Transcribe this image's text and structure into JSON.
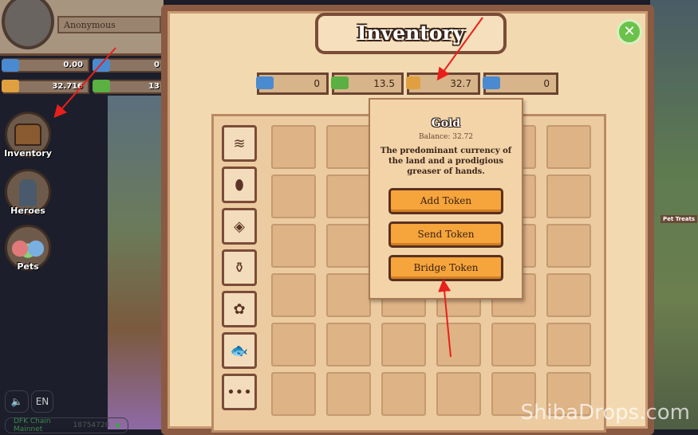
{
  "profile": {
    "name": "Anonymous"
  },
  "sidebar_balances": [
    "0.00",
    "0",
    "32.716",
    "13"
  ],
  "nav": [
    {
      "label": "Inventory"
    },
    {
      "label": "Heroes"
    },
    {
      "label": "Pets"
    }
  ],
  "footer": {
    "sound_icon": "speaker-icon",
    "language": "EN",
    "network": "DFK Chain Mainnet",
    "block": "18754728",
    "status_color": "#3fa34d"
  },
  "modal": {
    "title": "Inventory",
    "close_icon": "close-icon",
    "currencies": [
      {
        "icon": "crystal-icon",
        "value": "0",
        "color": "#4a8ad0"
      },
      {
        "icon": "jewel-icon",
        "value": "13.5",
        "color": "#5ab040"
      },
      {
        "icon": "gold-icon",
        "value": "32.7",
        "color": "#e0a040"
      },
      {
        "icon": "token-icon",
        "value": "0",
        "color": "#4a8ad0"
      }
    ],
    "categories": [
      {
        "icon": "layers-icon",
        "glyph": "≋"
      },
      {
        "icon": "egg-icon",
        "glyph": "⬮"
      },
      {
        "icon": "stone-icon",
        "glyph": "◈"
      },
      {
        "icon": "potion-icon",
        "glyph": "⚱"
      },
      {
        "icon": "plant-icon",
        "glyph": "✿"
      },
      {
        "icon": "fish-icon",
        "glyph": "🐟"
      },
      {
        "icon": "more-icon",
        "glyph": "•••"
      }
    ]
  },
  "tooltip": {
    "title": "Gold",
    "balance": "Balance: 32.72",
    "description": "The predominant currency of the land and a prodigious greaser of hands.",
    "buttons": [
      "Add Token",
      "Send Token",
      "Bridge Token"
    ]
  },
  "scene": {
    "pet_treats": "Pet Treats"
  },
  "watermark": "ShibaDrops.com"
}
